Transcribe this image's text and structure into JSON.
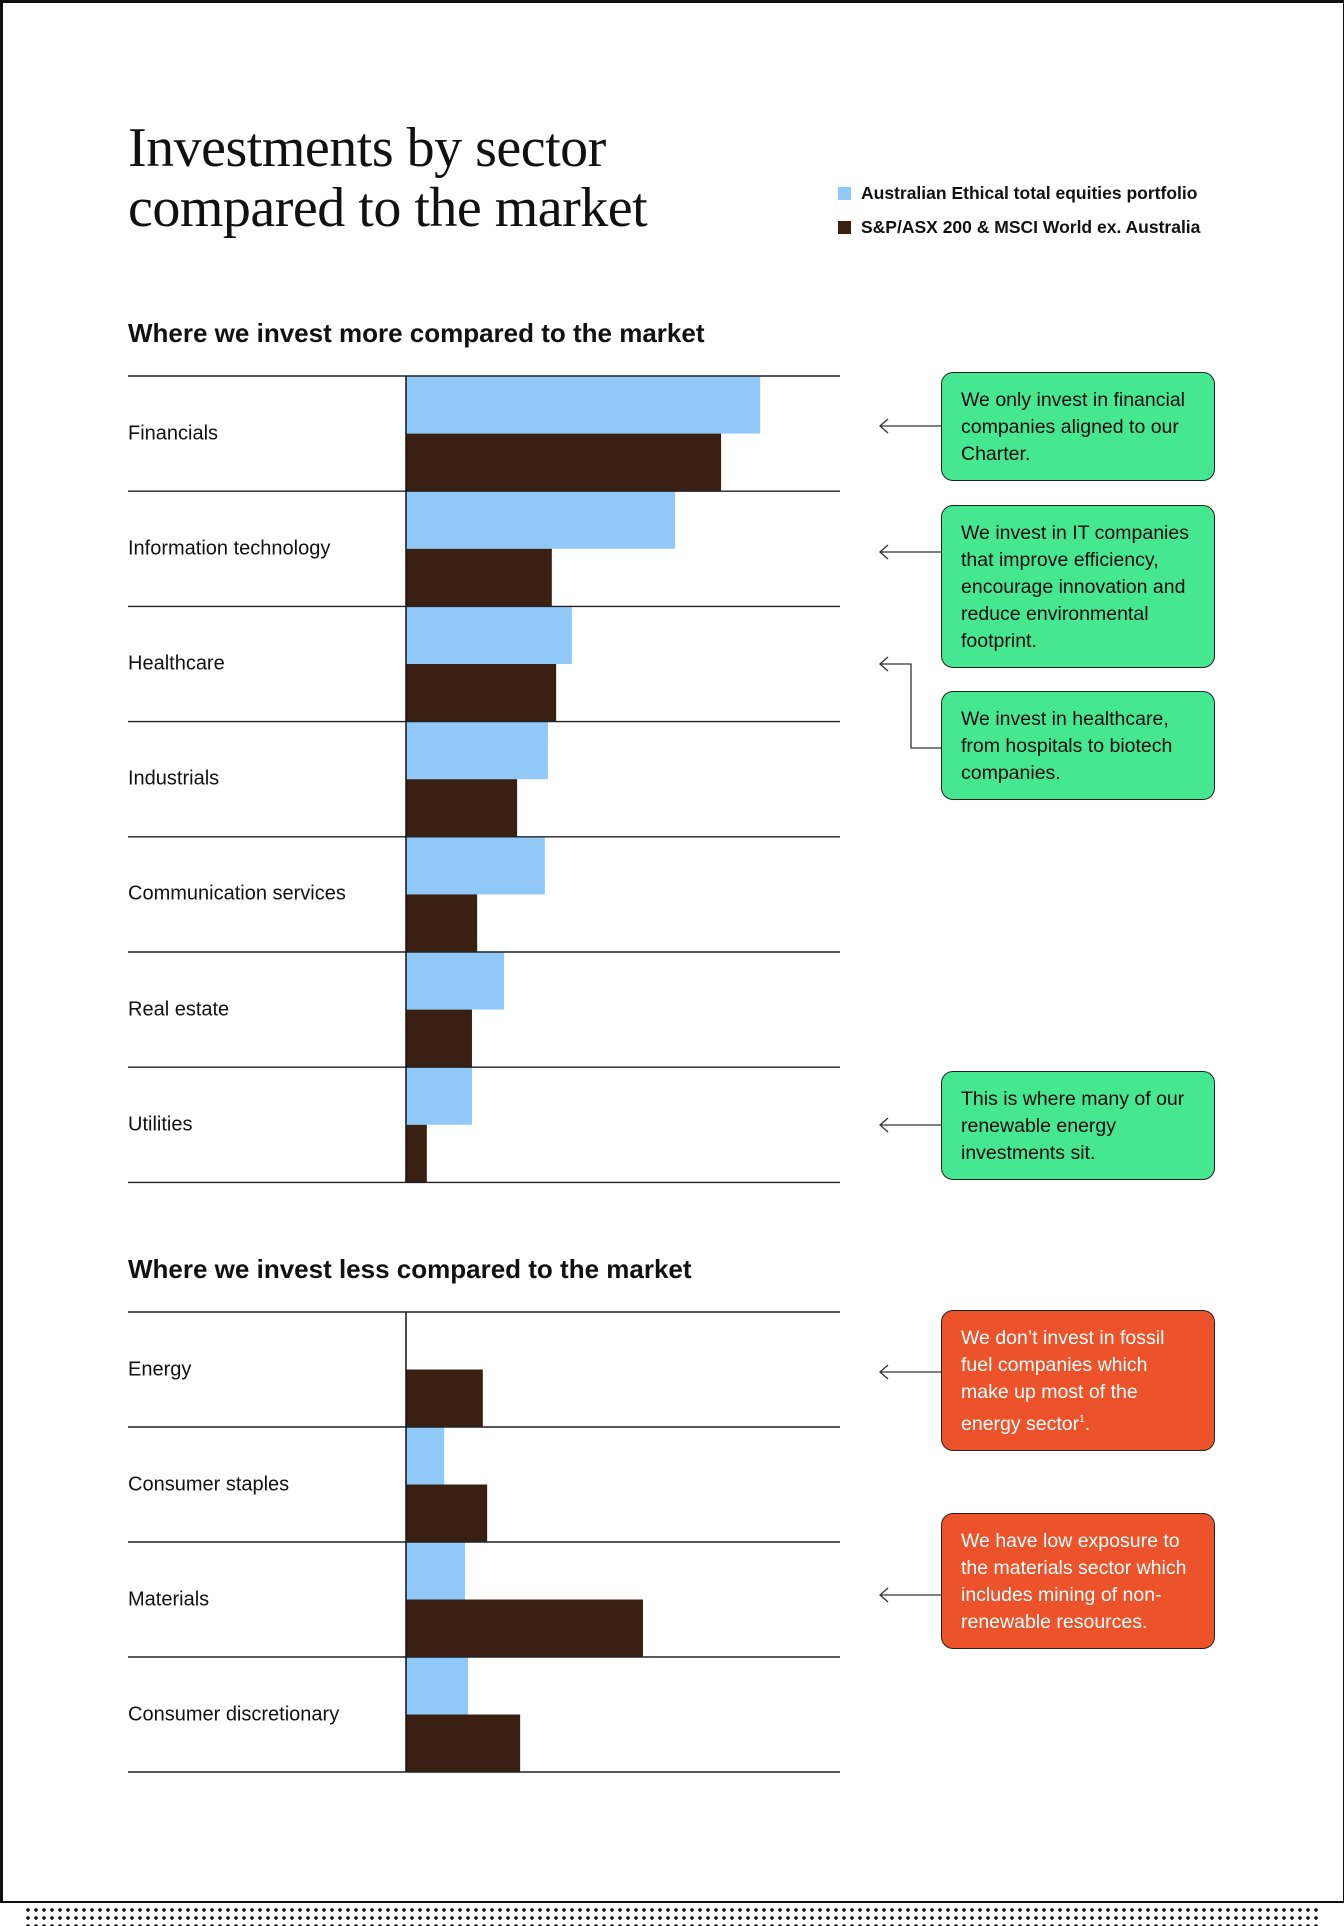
{
  "title": "Investments by sector\ncompared to the market",
  "legend": [
    {
      "label": "Australian Ethical total equities portfolio",
      "color": "#90c9f7"
    },
    {
      "label": "S&P/ASX 200 & MSCI World ex. Australia",
      "color": "#3a1f13"
    }
  ],
  "colors": {
    "portfolio": "#90c9f7",
    "market": "#3a1f13",
    "callout_positive": "#45e890",
    "callout_negative": "#ec532b"
  },
  "chart_data": [
    {
      "type": "bar",
      "orientation": "horizontal",
      "title": "Where we invest more compared to the market",
      "xlabel": "",
      "ylabel": "",
      "unit": "relative bar length (no axis shown; 100 = full plot width)",
      "xlim": [
        0,
        100
      ],
      "grid": false,
      "legend_position": "top-right",
      "categories": [
        "Financials",
        "Information technology",
        "Healthcare",
        "Industrials",
        "Communication services",
        "Real estate",
        "Utilities"
      ],
      "series": [
        {
          "name": "Australian Ethical total equities portfolio",
          "values": [
            81.6,
            62.0,
            38.2,
            32.7,
            32.0,
            22.6,
            15.2
          ]
        },
        {
          "name": "S&P/ASX 200 & MSCI World ex. Australia",
          "values": [
            72.6,
            33.6,
            34.6,
            25.6,
            16.4,
            15.2,
            4.8
          ]
        }
      ]
    },
    {
      "type": "bar",
      "orientation": "horizontal",
      "title": "Where we invest less compared to the market",
      "xlabel": "",
      "ylabel": "",
      "unit": "relative bar length (no axis shown; 100 = full plot width)",
      "xlim": [
        0,
        100
      ],
      "grid": false,
      "legend_position": "top-right",
      "categories": [
        "Energy",
        "Consumer staples",
        "Materials",
        "Consumer discretionary"
      ],
      "series": [
        {
          "name": "Australian Ethical total equities portfolio",
          "values": [
            0,
            8.8,
            13.6,
            14.3
          ]
        },
        {
          "name": "S&P/ASX 200 & MSCI World ex. Australia",
          "values": [
            17.7,
            18.7,
            54.6,
            26.3
          ]
        }
      ]
    }
  ],
  "callouts": [
    {
      "text": "We only invest in financial companies aligned to our Charter.",
      "tone": "positive",
      "points_to": "Financials"
    },
    {
      "text": "We invest in IT companies that improve efficiency, encourage innovation and reduce environmental footprint.",
      "tone": "positive",
      "points_to": "Information technology"
    },
    {
      "text": "We invest in healthcare, from hospitals to biotech companies.",
      "tone": "positive",
      "points_to": "Healthcare"
    },
    {
      "text": "This is where many of our renewable energy investments sit.",
      "tone": "positive",
      "points_to": "Utilities"
    },
    {
      "text": "We don’t invest in fossil fuel companies which make up most of the energy sector",
      "footnote": "1",
      "suffix": ".",
      "tone": "negative",
      "points_to": "Energy"
    },
    {
      "text": "We have low exposure to the materials sector which includes mining of non-renewable resources.",
      "tone": "negative",
      "points_to": "Materials"
    }
  ]
}
